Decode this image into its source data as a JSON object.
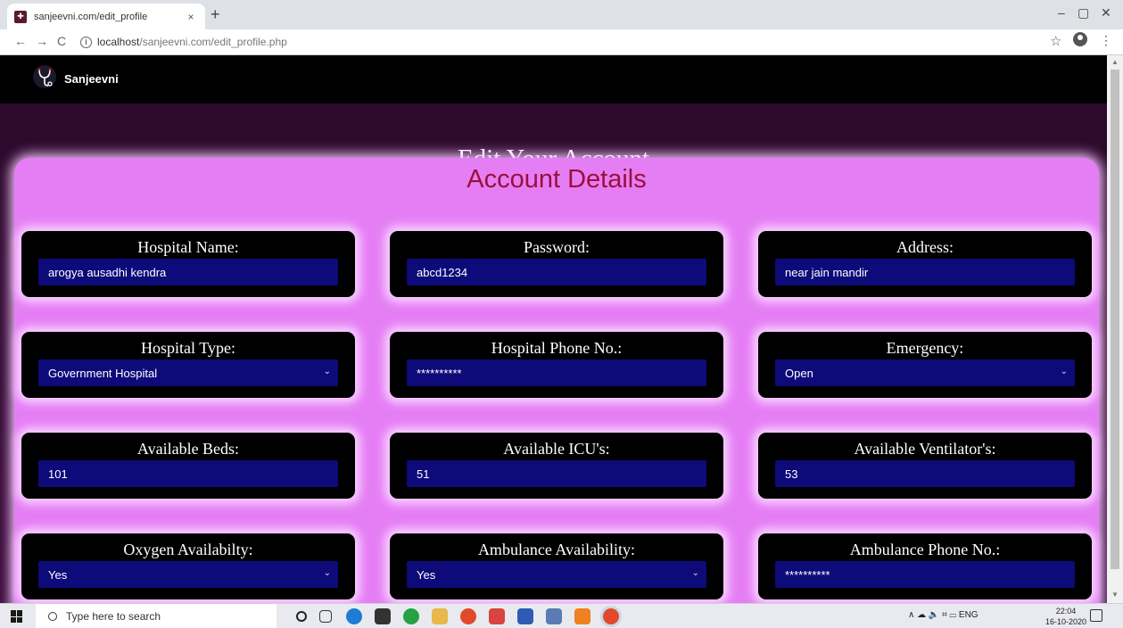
{
  "browser": {
    "tab_title": "sanjeevni.com/edit_profile",
    "tab_close": "×",
    "new_tab": "+",
    "url_host": "localhost",
    "url_path": "/sanjeevni.com/edit_profile.php"
  },
  "navbar": {
    "brand": "Sanjeevni"
  },
  "page": {
    "heading": "Edit Your Account",
    "panel_title": "Account Details"
  },
  "fields": {
    "hospital_name": {
      "label": "Hospital Name:",
      "value": "arogya ausadhi kendra"
    },
    "password": {
      "label": "Password:",
      "value": "abcd1234"
    },
    "address": {
      "label": "Address:",
      "value": "near jain mandir"
    },
    "hospital_type": {
      "label": "Hospital Type:",
      "value": "Government Hospital"
    },
    "hospital_phone": {
      "label": "Hospital Phone No.:",
      "value": "**********"
    },
    "emergency": {
      "label": "Emergency:",
      "value": "Open"
    },
    "beds": {
      "label": "Available Beds:",
      "value": "101"
    },
    "icus": {
      "label": "Available ICU's:",
      "value": "51"
    },
    "ventilators": {
      "label": "Available Ventilator's:",
      "value": "53"
    },
    "oxygen": {
      "label": "Oxygen Availabilty:",
      "value": "Yes"
    },
    "ambulance": {
      "label": "Ambulance Availability:",
      "value": "Yes"
    },
    "ambulance_phone": {
      "label": "Ambulance Phone No.:",
      "value": "**********"
    }
  },
  "taskbar": {
    "search_placeholder": "Type here to search",
    "lang": "ENG",
    "time": "22:04",
    "date": "16-10-2020"
  },
  "colors": {
    "panel": "#e57ef5",
    "field": "#0d0a7a",
    "title_red": "#9b0f3b"
  }
}
